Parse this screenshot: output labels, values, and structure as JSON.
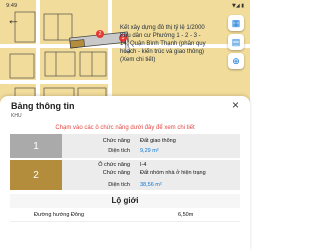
{
  "status": {
    "time": "9:49",
    "right": "▼◢ ▮"
  },
  "map": {
    "labels": [
      "2",
      "3"
    ],
    "icons": [
      "grid-icon",
      "map-icon",
      "crosshair-icon"
    ],
    "overlay_lines": [
      "Kết xây dựng đô thị tỷ lệ 1/2000",
      "Khu dân cư Phường 1 - 2 - 3 -",
      "14, Quận Bình Thạnh (phân quy",
      "hoạch - kiến trúc và giao thông)",
      "(Xem chi tiết)"
    ]
  },
  "sheet": {
    "title": "Bảng thông tin",
    "close": "×",
    "subtitle": "KHU",
    "hint": "Chạm vào các ô chức năng dưới đây để xem chi tiết",
    "row1": {
      "num": "1",
      "label1": "Chức năng",
      "value1": "Đất giao thông",
      "label2": "Diện tích",
      "value2": "9,29 m²"
    },
    "row2": {
      "num": "2",
      "label1": "Ô chức năng",
      "value1": "I-4",
      "label2": "Chức năng",
      "value2": "Đất nhóm nhà ở hiện trạng",
      "label3": "Diện tích",
      "value3": "38,56 m²"
    },
    "lo_gioi": "Lộ giới",
    "road": {
      "name": "Đường hướng Đông",
      "width": "6,50m"
    }
  },
  "colors": {
    "map_bg": "#f2dc9b",
    "row1_num": "#aaaaaa",
    "row2_num": "#b38d3b",
    "hint": "#e04a44",
    "accent": "#0a74d6"
  }
}
